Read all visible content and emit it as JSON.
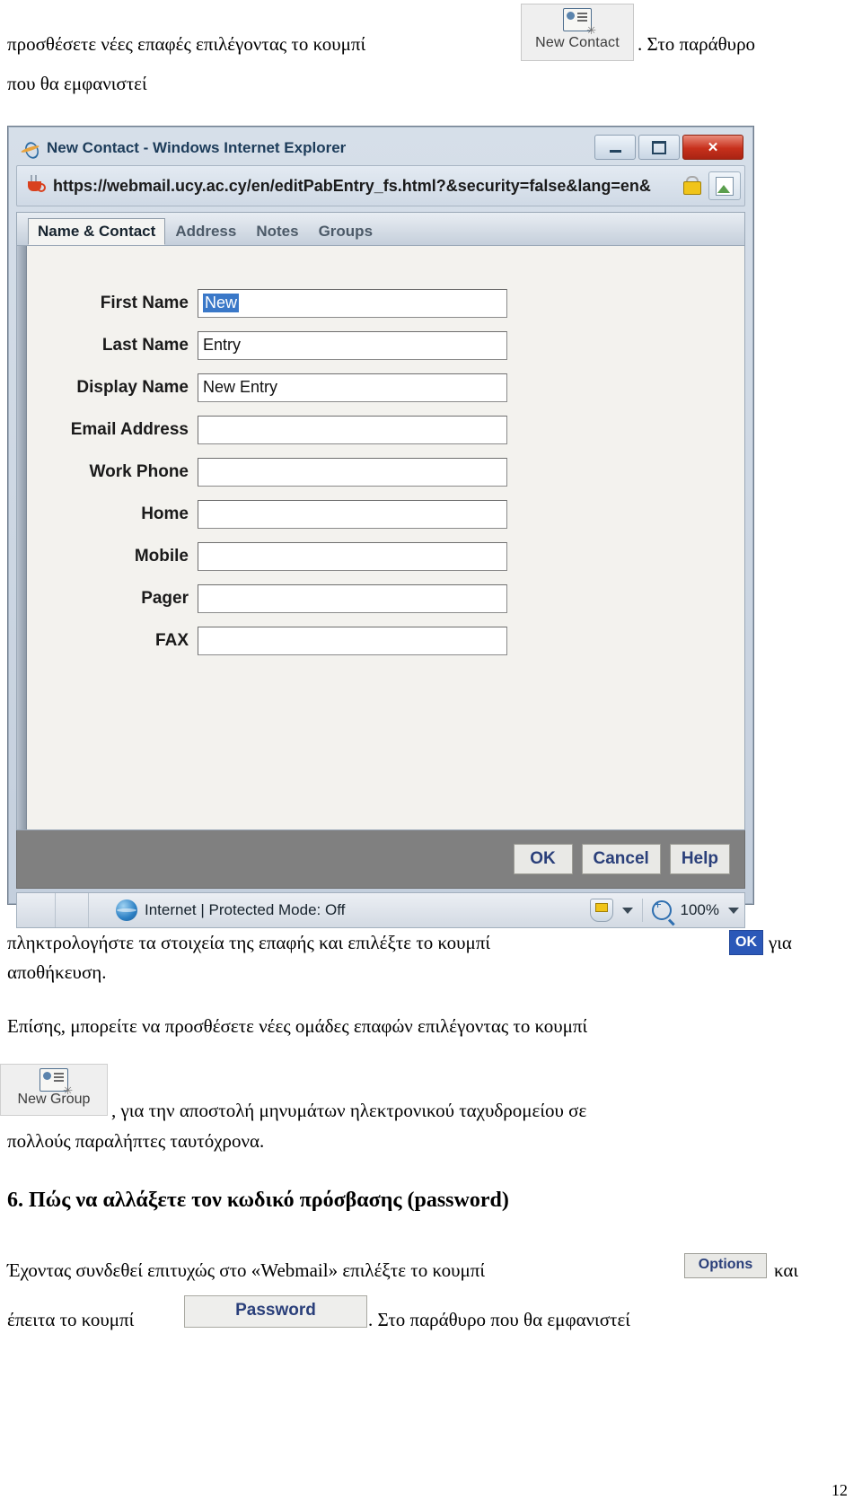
{
  "document": {
    "page_number": "12",
    "intro_line1": "προσθέσετε νέες επαφές επιλέγοντας το κουμπί",
    "intro_after_button": ". Στο παράθυρο",
    "intro_line2": "που θα εμφανιστεί",
    "new_contact_button_label": "New Contact",
    "after_window_line1": "πληκτρολογήστε τα στοιχεία της επαφής και επιλέξτε το κουμπί",
    "after_window_ok": "OK",
    "after_window_tail": "για",
    "after_window_line2": "αποθήκευση.",
    "groups_line": "Επίσης, μπορείτε να προσθέσετε νέες ομάδες επαφών επιλέγοντας το κουμπί",
    "new_group_button_label": "New Group",
    "groups_after_button": ", για την αποστολή μηνυμάτων ηλεκτρονικού ταχυδρομείου σε",
    "groups_line3": "πολλούς παραλήπτες ταυτόχρονα.",
    "section_heading": "6. Πώς να αλλάξετε τον κωδικό πρόσβασης (password)",
    "password_line1": "Έχοντας συνδεθεί επιτυχώς στο «Webmail» επιλέξτε το κουμπί",
    "options_button_label": "Options",
    "password_line1_tail": "και",
    "password_line2_head": "έπειτα το κουμπί",
    "password_button_label": "Password",
    "password_line2_tail": ". Στο παράθυρο που θα εμφανιστεί"
  },
  "browser_window": {
    "title": "New Contact - Windows Internet Explorer",
    "address": "https://webmail.ucy.ac.cy/en/editPabEntry_fs.html?&security=false&lang=en&",
    "window_controls": {
      "minimize": "_",
      "maximize": "□",
      "close": "✕"
    },
    "tabs": [
      {
        "label": "Name & Contact",
        "active": true
      },
      {
        "label": "Address",
        "active": false
      },
      {
        "label": "Notes",
        "active": false
      },
      {
        "label": "Groups",
        "active": false
      }
    ],
    "form_fields": [
      {
        "label": "First Name",
        "value": "New",
        "selected": true
      },
      {
        "label": "Last Name",
        "value": "Entry",
        "selected": false
      },
      {
        "label": "Display Name",
        "value": "New Entry",
        "selected": false
      },
      {
        "label": "Email Address",
        "value": "",
        "selected": false
      },
      {
        "label": "Work Phone",
        "value": "",
        "selected": false
      },
      {
        "label": "Home",
        "value": "",
        "selected": false
      },
      {
        "label": "Mobile",
        "value": "",
        "selected": false
      },
      {
        "label": "Pager",
        "value": "",
        "selected": false
      },
      {
        "label": "FAX",
        "value": "",
        "selected": false
      }
    ],
    "dialog_buttons": [
      {
        "label": "OK"
      },
      {
        "label": "Cancel"
      },
      {
        "label": "Help"
      }
    ],
    "status_bar": {
      "zone_text": "Internet | Protected Mode: Off",
      "zoom_level": "100%"
    }
  },
  "colors": {
    "selection_blue": "#3a78c8",
    "button_text_blue": "#2a3f7a",
    "close_red": "#c7301c"
  }
}
